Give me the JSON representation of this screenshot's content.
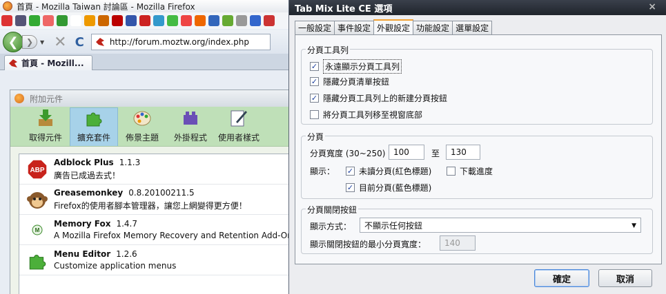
{
  "firefox": {
    "title": "首頁 - Mozilla Taiwan 討論區 - Mozilla Firefox",
    "url": "http://forum.moztw.org/index.php",
    "tab_label": "首頁 - Mozill..."
  },
  "addons": {
    "title": "附加元件",
    "toolbar": [
      {
        "label": "取得元件",
        "icon": "download-addon-icon"
      },
      {
        "label": "擴充套件",
        "icon": "puzzle-icon"
      },
      {
        "label": "佈景主題",
        "icon": "palette-icon"
      },
      {
        "label": "外掛程式",
        "icon": "plugin-brick-icon"
      },
      {
        "label": "使用者樣式",
        "icon": "pen-paper-icon"
      }
    ],
    "list": [
      {
        "name": "Adblock Plus",
        "version": "1.1.3",
        "desc": "廣告已成過去式！",
        "icon": "abp-icon"
      },
      {
        "name": "Greasemonkey",
        "version": "0.8.20100211.5",
        "desc": "Firefox的使用者腳本管理器，讓您上網變得更方便！",
        "icon": "monkey-icon"
      },
      {
        "name": "Memory Fox",
        "version": "1.4.7",
        "desc": "A Mozilla Firefox Memory Recovery and Retention Add-On",
        "icon": "memory-icon"
      },
      {
        "name": "Menu Editor",
        "version": "1.2.6",
        "desc": "Customize application menus",
        "icon": "puzzle-small-icon"
      }
    ]
  },
  "dialog": {
    "title": "Tab Mix Lite CE 選項",
    "close": "×",
    "tabs": [
      "一般設定",
      "事件設定",
      "外觀設定",
      "功能設定",
      "選單設定"
    ],
    "active_tab": 2,
    "tabbar_group": {
      "title": "分頁工具列",
      "options": [
        {
          "label": "永遠顯示分頁工具列",
          "checked": true
        },
        {
          "label": "隱藏分頁清單按鈕",
          "checked": true
        },
        {
          "label": "隱藏分頁工具列上的新建分頁按鈕",
          "checked": true
        },
        {
          "label": "將分頁工具列移至視窗底部",
          "checked": false
        }
      ]
    },
    "tab_group": {
      "title": "分頁",
      "width_label": "分頁寬度 (30~250)",
      "width_min": "100",
      "to_label": "至",
      "width_max": "130",
      "show_label": "顯示：",
      "unread_label": "未讀分頁(紅色標題)",
      "unread_checked": true,
      "progress_label": "下載進度",
      "progress_checked": false,
      "current_label": "目前分頁(藍色標題)",
      "current_checked": true
    },
    "close_group": {
      "title": "分頁關閉按鈕",
      "mode_label": "顯示方式：",
      "mode_value": "不顯示任何按鈕",
      "minwidth_label": "顯示關閉按鈕的最小分頁寬度：",
      "minwidth_value": "140"
    },
    "ok_label": "確定",
    "cancel_label": "取消"
  }
}
